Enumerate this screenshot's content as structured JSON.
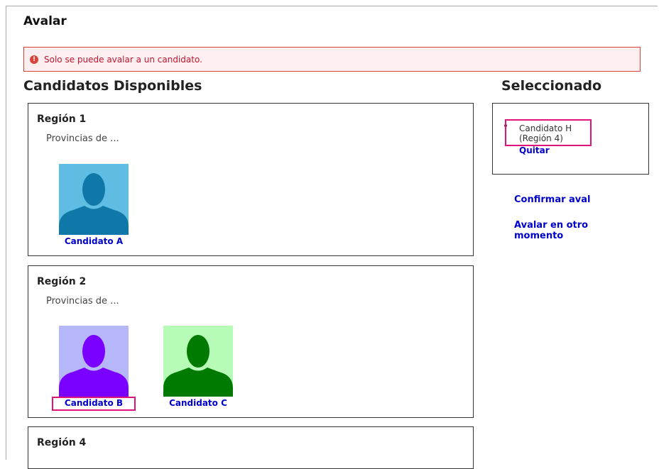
{
  "page": {
    "title": "Avalar"
  },
  "alert": {
    "icon": "exclamation-circle-icon",
    "message": "Solo se puede avalar a un candidato."
  },
  "available": {
    "heading": "Candidatos Disponibles",
    "regions": [
      {
        "title": "Región 1",
        "subtitle": "Provincias de ...",
        "candidates": [
          {
            "name": "Candidato A",
            "bg": "#5fbde3",
            "fg": "#0f78a8"
          }
        ]
      },
      {
        "title": "Región 2",
        "subtitle": "Provincias de ...",
        "candidates": [
          {
            "name": "Candidato B",
            "bg": "#b7b7fc",
            "fg": "#7a00ff",
            "highlighted": true
          },
          {
            "name": "Candidato C",
            "bg": "#b6fcb6",
            "fg": "#007a00"
          }
        ]
      },
      {
        "title": "Región 4"
      }
    ]
  },
  "selected": {
    "heading": "Seleccionado",
    "item": {
      "name_line1": "Candidato H",
      "name_line2": "(Región 4)",
      "remove_label": "Quitar"
    }
  },
  "actions": {
    "confirm": "Confirmar aval",
    "later_line1": "Avalar en otro",
    "later_line2": "momento"
  },
  "colors": {
    "link": "#0000cc",
    "highlight": "#e0137a",
    "alert_border": "#e0413d",
    "alert_bg": "#fdeef0"
  }
}
